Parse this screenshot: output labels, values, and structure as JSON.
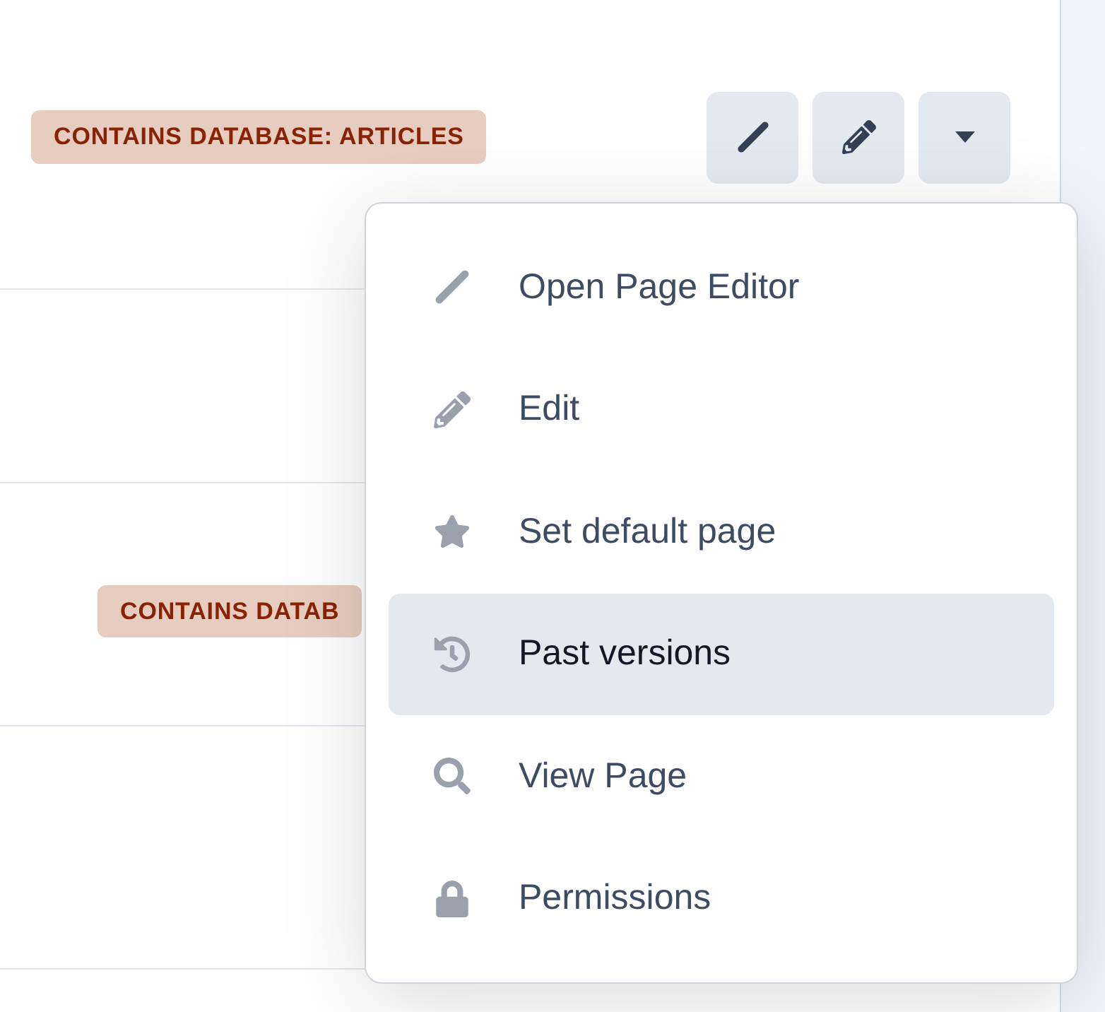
{
  "rows": [
    {
      "badge": "CONTAINS DATABASE: ARTICLES",
      "actions": [
        {
          "kind": "line"
        },
        {
          "kind": "pencil"
        },
        {
          "kind": "caret"
        }
      ]
    },
    {},
    {
      "badge": "CONTAINS DATAB"
    },
    {}
  ],
  "menu": {
    "items": [
      {
        "kind": "line",
        "label": "Open Page Editor",
        "selected": false
      },
      {
        "kind": "pencil",
        "label": "Edit",
        "selected": false
      },
      {
        "kind": "star",
        "label": "Set default page",
        "selected": false
      },
      {
        "kind": "history",
        "label": "Past versions",
        "selected": true
      },
      {
        "kind": "search",
        "label": "View Page",
        "selected": false
      },
      {
        "kind": "lock",
        "label": "Permissions",
        "selected": false
      }
    ]
  }
}
